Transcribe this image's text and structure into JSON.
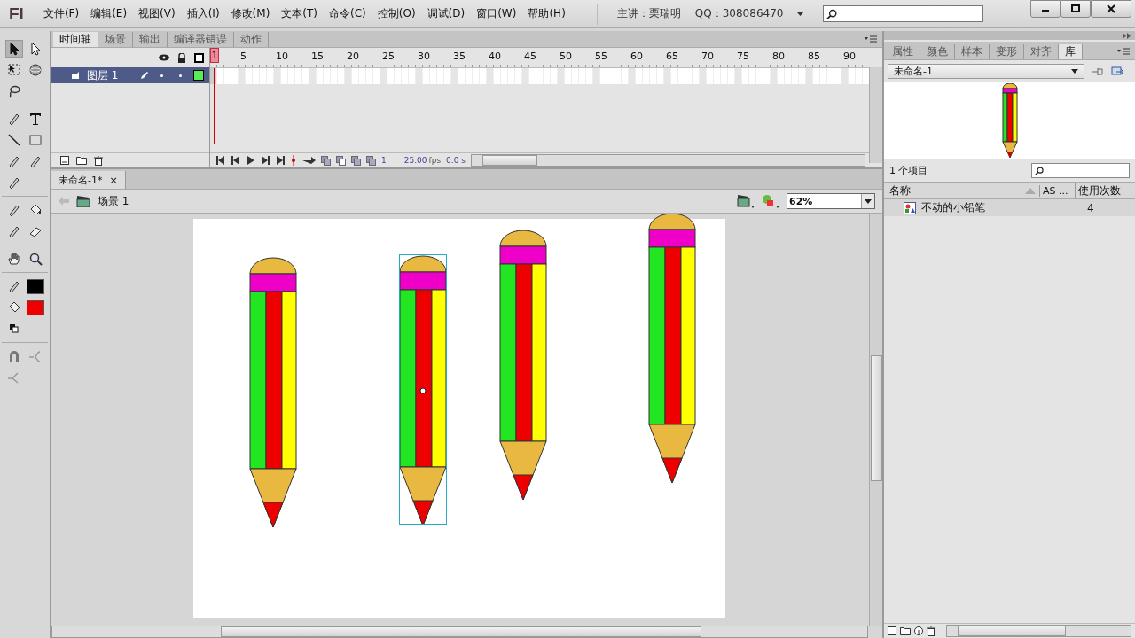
{
  "menu_bar": {
    "logo": "Fl",
    "items": [
      "文件(F)",
      "编辑(E)",
      "视图(V)",
      "插入(I)",
      "修改(M)",
      "文本(T)",
      "命令(C)",
      "控制(O)",
      "调试(D)",
      "窗口(W)",
      "帮助(H)"
    ],
    "presenter": "主讲：栗瑞明",
    "qq": "QQ：308086470"
  },
  "tools": {
    "swatches": [
      {
        "kind": "stroke",
        "color": "#000000"
      },
      {
        "kind": "fill",
        "color": "#ee0000"
      }
    ]
  },
  "timeline": {
    "tabs": [
      {
        "label": "时间轴",
        "selected": true
      },
      {
        "label": "场景",
        "selected": false
      },
      {
        "label": "输出",
        "selected": false
      },
      {
        "label": "编译器错误",
        "selected": false
      },
      {
        "label": "动作",
        "selected": false
      }
    ],
    "frame_numbers": [
      "1",
      "5",
      "10",
      "15",
      "20",
      "25",
      "30",
      "35",
      "40",
      "45",
      "50",
      "55",
      "60",
      "65",
      "70",
      "75",
      "80",
      "85",
      "90"
    ],
    "layers": [
      {
        "name": "图层 1",
        "selected": true
      }
    ],
    "current_frame": "1",
    "frame_rate": "25.00",
    "fps_unit": "fps",
    "elapsed": "0.0 s"
  },
  "document_tab": {
    "title": "未命名-1*",
    "close": "×"
  },
  "edit_bar": {
    "scene": "场景 1",
    "zoom": "62%"
  },
  "stage": {
    "pencils": [
      {
        "selected": false
      },
      {
        "selected": true
      },
      {
        "selected": false
      },
      {
        "selected": false
      }
    ]
  },
  "library": {
    "tabs": [
      {
        "label": "属性",
        "selected": false
      },
      {
        "label": "颜色",
        "selected": false
      },
      {
        "label": "样本",
        "selected": false
      },
      {
        "label": "变形",
        "selected": false
      },
      {
        "label": "对齐",
        "selected": false
      },
      {
        "label": "库",
        "selected": true
      }
    ],
    "document": "未命名-1",
    "item_count": "1 个项目",
    "columns": [
      "名称",
      "AS ...",
      "使用次数"
    ],
    "items": [
      {
        "name": "不动的小铅笔",
        "use_count": "4",
        "selected": true
      }
    ]
  }
}
